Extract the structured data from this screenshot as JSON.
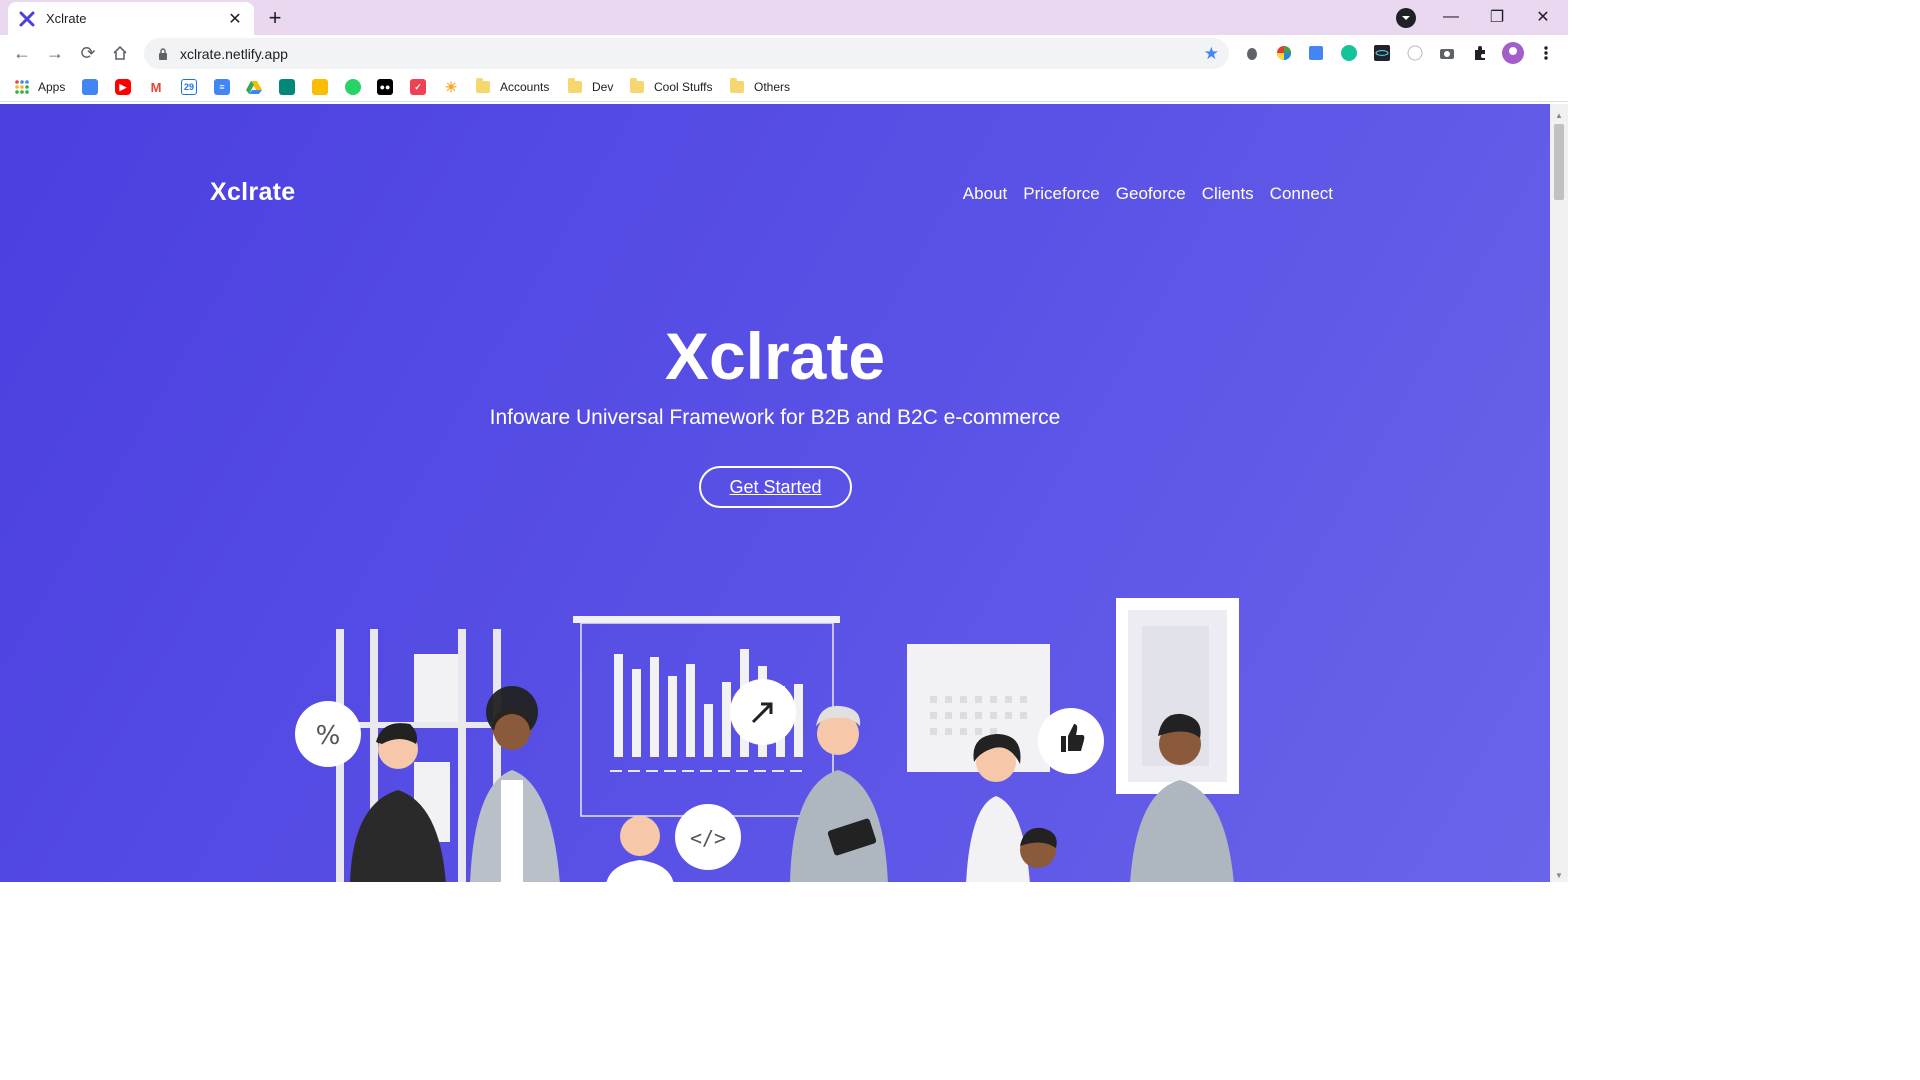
{
  "browser": {
    "tab": {
      "title": "Xclrate"
    },
    "url": "xclrate.netlify.app",
    "bookmarks": {
      "apps_label": "Apps",
      "calendar_day": "29",
      "folders": [
        "Accounts",
        "Dev",
        "Cool Stuffs",
        "Others"
      ]
    }
  },
  "site": {
    "logo": "Xclrate",
    "nav": [
      "About",
      "Priceforce",
      "Geoforce",
      "Clients",
      "Connect"
    ],
    "hero": {
      "title": "Xclrate",
      "subtitle": "Infoware Universal Framework for B2B and B2C e-commerce",
      "cta": "Get Started"
    },
    "illustration": {
      "percent_symbol": "%",
      "code_symbol": "</>"
    }
  },
  "colors": {
    "hero_bg_start": "#4b3fe0",
    "hero_bg_end": "#6a64ea",
    "tabstrip_bg": "#e9d8f0"
  }
}
